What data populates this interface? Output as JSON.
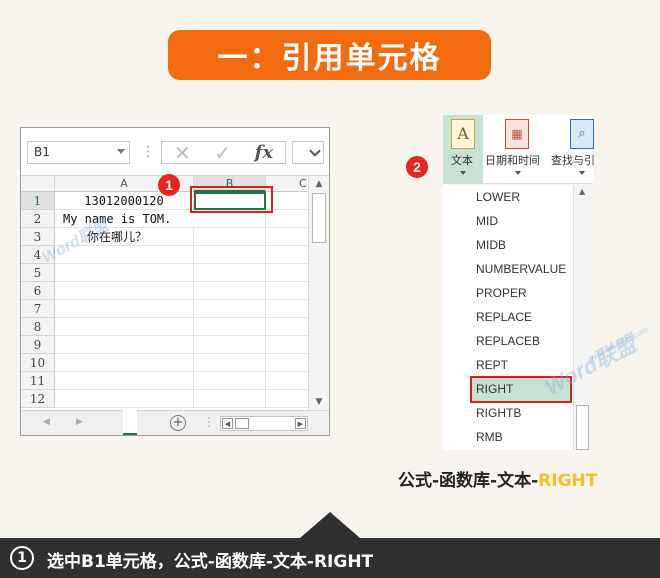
{
  "title": "一：引用单元格",
  "excel": {
    "name_box": "B1",
    "columns": [
      "A",
      "B",
      "C"
    ],
    "rows": [
      "1",
      "2",
      "3",
      "4",
      "5",
      "6",
      "7",
      "8",
      "9",
      "10",
      "11",
      "12"
    ],
    "cells": {
      "A1": "13012000120",
      "A2": "My name is TOM.",
      "A3": "你在哪儿？"
    }
  },
  "ribbon": {
    "text_label": "文本",
    "datetime_label": "日期和时间",
    "lookup_label": "查找与引"
  },
  "functions": [
    "LOWER",
    "MID",
    "MIDB",
    "NUMBERVALUE",
    "PROPER",
    "REPLACE",
    "REPLACEB",
    "REPT",
    "RIGHT",
    "RIGHTB",
    "RMB"
  ],
  "selected_function": "RIGHT",
  "badges": [
    "1",
    "2"
  ],
  "caption": {
    "prefix": "公式-函数库-文本-",
    "highlight": "RIGHT"
  },
  "footer": {
    "step_number": "1",
    "text": "选中B1单元格，公式-函数库-文本-RIGHT"
  },
  "watermarks": [
    "Word联盟",
    "www.wordlm.com"
  ],
  "colors": {
    "banner": "#f26c0f",
    "selection_green": "#c7e2d2",
    "highlight_box": "#d51f1f",
    "caption_highlight": "#f6c026",
    "footer_bg": "#303030"
  }
}
